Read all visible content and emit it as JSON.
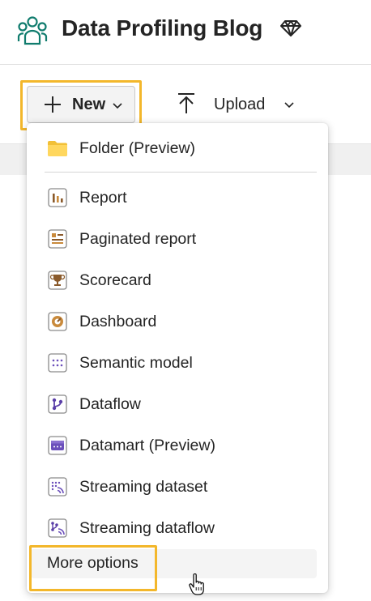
{
  "workspace": {
    "title": "Data Profiling Blog",
    "icon": "workspace-people-icon",
    "badge_icon": "premium-diamond-icon"
  },
  "toolbar": {
    "new_label": "New",
    "upload_label": "Upload"
  },
  "menu": {
    "items": [
      {
        "label": "Folder (Preview)",
        "icon": "folder-icon"
      },
      {
        "label": "Report",
        "icon": "report-icon"
      },
      {
        "label": "Paginated report",
        "icon": "paginated-report-icon"
      },
      {
        "label": "Scorecard",
        "icon": "scorecard-icon"
      },
      {
        "label": "Dashboard",
        "icon": "dashboard-icon"
      },
      {
        "label": "Semantic model",
        "icon": "semantic-model-icon"
      },
      {
        "label": "Dataflow",
        "icon": "dataflow-icon"
      },
      {
        "label": "Datamart (Preview)",
        "icon": "datamart-icon"
      },
      {
        "label": "Streaming dataset",
        "icon": "streaming-dataset-icon"
      },
      {
        "label": "Streaming dataflow",
        "icon": "streaming-dataflow-icon"
      }
    ],
    "more_label": "More options"
  },
  "colors": {
    "highlight": "#f3b72b",
    "workspace_icon": "#107c6e",
    "purple_accent": "#6b4fbb",
    "report_brown": "#8a5a2b"
  }
}
